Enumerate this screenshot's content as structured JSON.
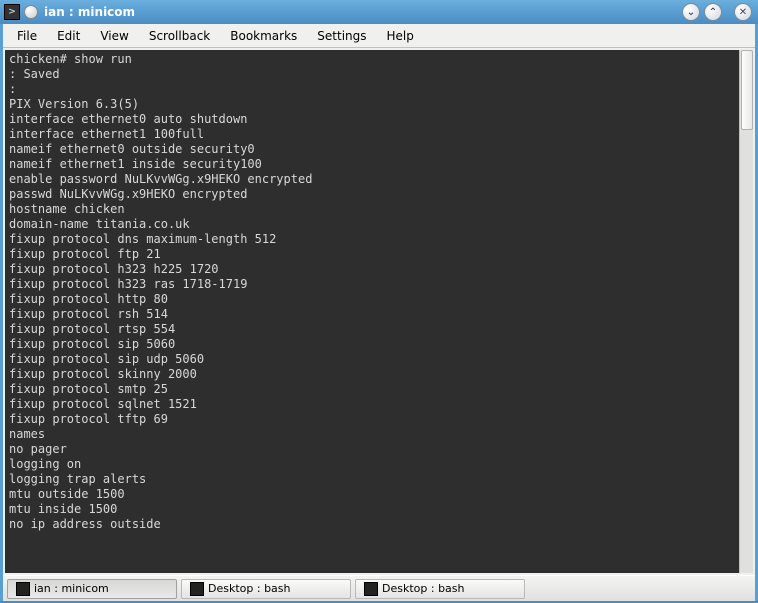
{
  "window": {
    "title": "ian : minicom"
  },
  "menubar": {
    "items": [
      "File",
      "Edit",
      "View",
      "Scrollback",
      "Bookmarks",
      "Settings",
      "Help"
    ]
  },
  "terminal": {
    "lines": [
      "chicken# show run",
      ": Saved",
      ":",
      "PIX Version 6.3(5)",
      "interface ethernet0 auto shutdown",
      "interface ethernet1 100full",
      "nameif ethernet0 outside security0",
      "nameif ethernet1 inside security100",
      "enable password NuLKvvWGg.x9HEKO encrypted",
      "passwd NuLKvvWGg.x9HEKO encrypted",
      "hostname chicken",
      "domain-name titania.co.uk",
      "fixup protocol dns maximum-length 512",
      "fixup protocol ftp 21",
      "fixup protocol h323 h225 1720",
      "fixup protocol h323 ras 1718-1719",
      "fixup protocol http 80",
      "fixup protocol rsh 514",
      "fixup protocol rtsp 554",
      "fixup protocol sip 5060",
      "fixup protocol sip udp 5060",
      "fixup protocol skinny 2000",
      "fixup protocol smtp 25",
      "fixup protocol sqlnet 1521",
      "fixup protocol tftp 69",
      "names",
      "no pager",
      "logging on",
      "logging trap alerts",
      "mtu outside 1500",
      "mtu inside 1500",
      "no ip address outside"
    ]
  },
  "taskbar": {
    "items": [
      {
        "label": "ian : minicom",
        "active": true
      },
      {
        "label": "Desktop : bash",
        "active": false
      },
      {
        "label": "Desktop : bash",
        "active": false
      }
    ]
  },
  "icons": {
    "minimize": "⌄",
    "maximize": "⌃",
    "close": "✕",
    "terminal_prompt": ">"
  }
}
